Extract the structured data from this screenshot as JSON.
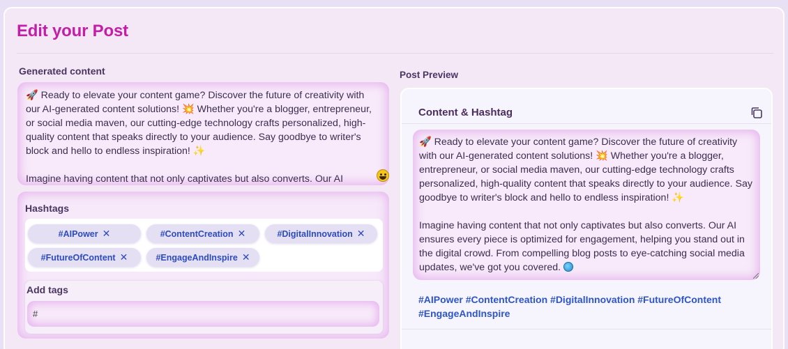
{
  "page": {
    "title": "Edit your Post"
  },
  "left": {
    "generated_label": "Generated content",
    "generated_text": "🚀 Ready to elevate your content game? Discover the future of creativity with our AI-generated content solutions! 💥 Whether you're a blogger, entrepreneur, or social media maven, our cutting-edge technology crafts personalized, high-quality content that speaks directly to your audience. Say goodbye to writer's block and hello to endless inspiration! ✨\n\nImagine having content that not only captivates but also converts. Our AI ensures",
    "hashtags_label": "Hashtags",
    "hashtags": [
      "#AIPower",
      "#ContentCreation",
      "#DigitalInnovation",
      "#FutureOfContent",
      "#EngageAndInspire"
    ],
    "remove_glyph": "✕",
    "add_tags_label": "Add tags",
    "add_tags_value": "#"
  },
  "right": {
    "preview_label": "Post Preview",
    "card_title": "Content & Hashtag",
    "preview_text": "🚀 Ready to elevate your content game? Discover the future of creativity with our AI-generated content solutions! 💥 Whether you're a blogger, entrepreneur, or social media maven, our cutting-edge technology crafts personalized, high-quality content that speaks directly to your audience. Say goodbye to writer's block and hello to endless inspiration! ✨\n\nImagine having content that not only captivates but also converts. Our AI ensures every piece is optimized for engagement, helping you stand out in the digital crowd. From compelling blog posts to eye-catching social media updates, we've got you covered.",
    "preview_hashtags": "#AIPower #ContentCreation #DigitalInnovation #FutureOfContent #EngageAndInspire"
  },
  "icons": {
    "copy": "copy-icon",
    "smiley": "grinning-face-icon",
    "globe": "globe-icon"
  },
  "colors": {
    "title": "#c21fa6",
    "hashtag": "#2d55c9",
    "chip_bg": "#e5dff3",
    "panel_bg": "#f4e8f7"
  }
}
